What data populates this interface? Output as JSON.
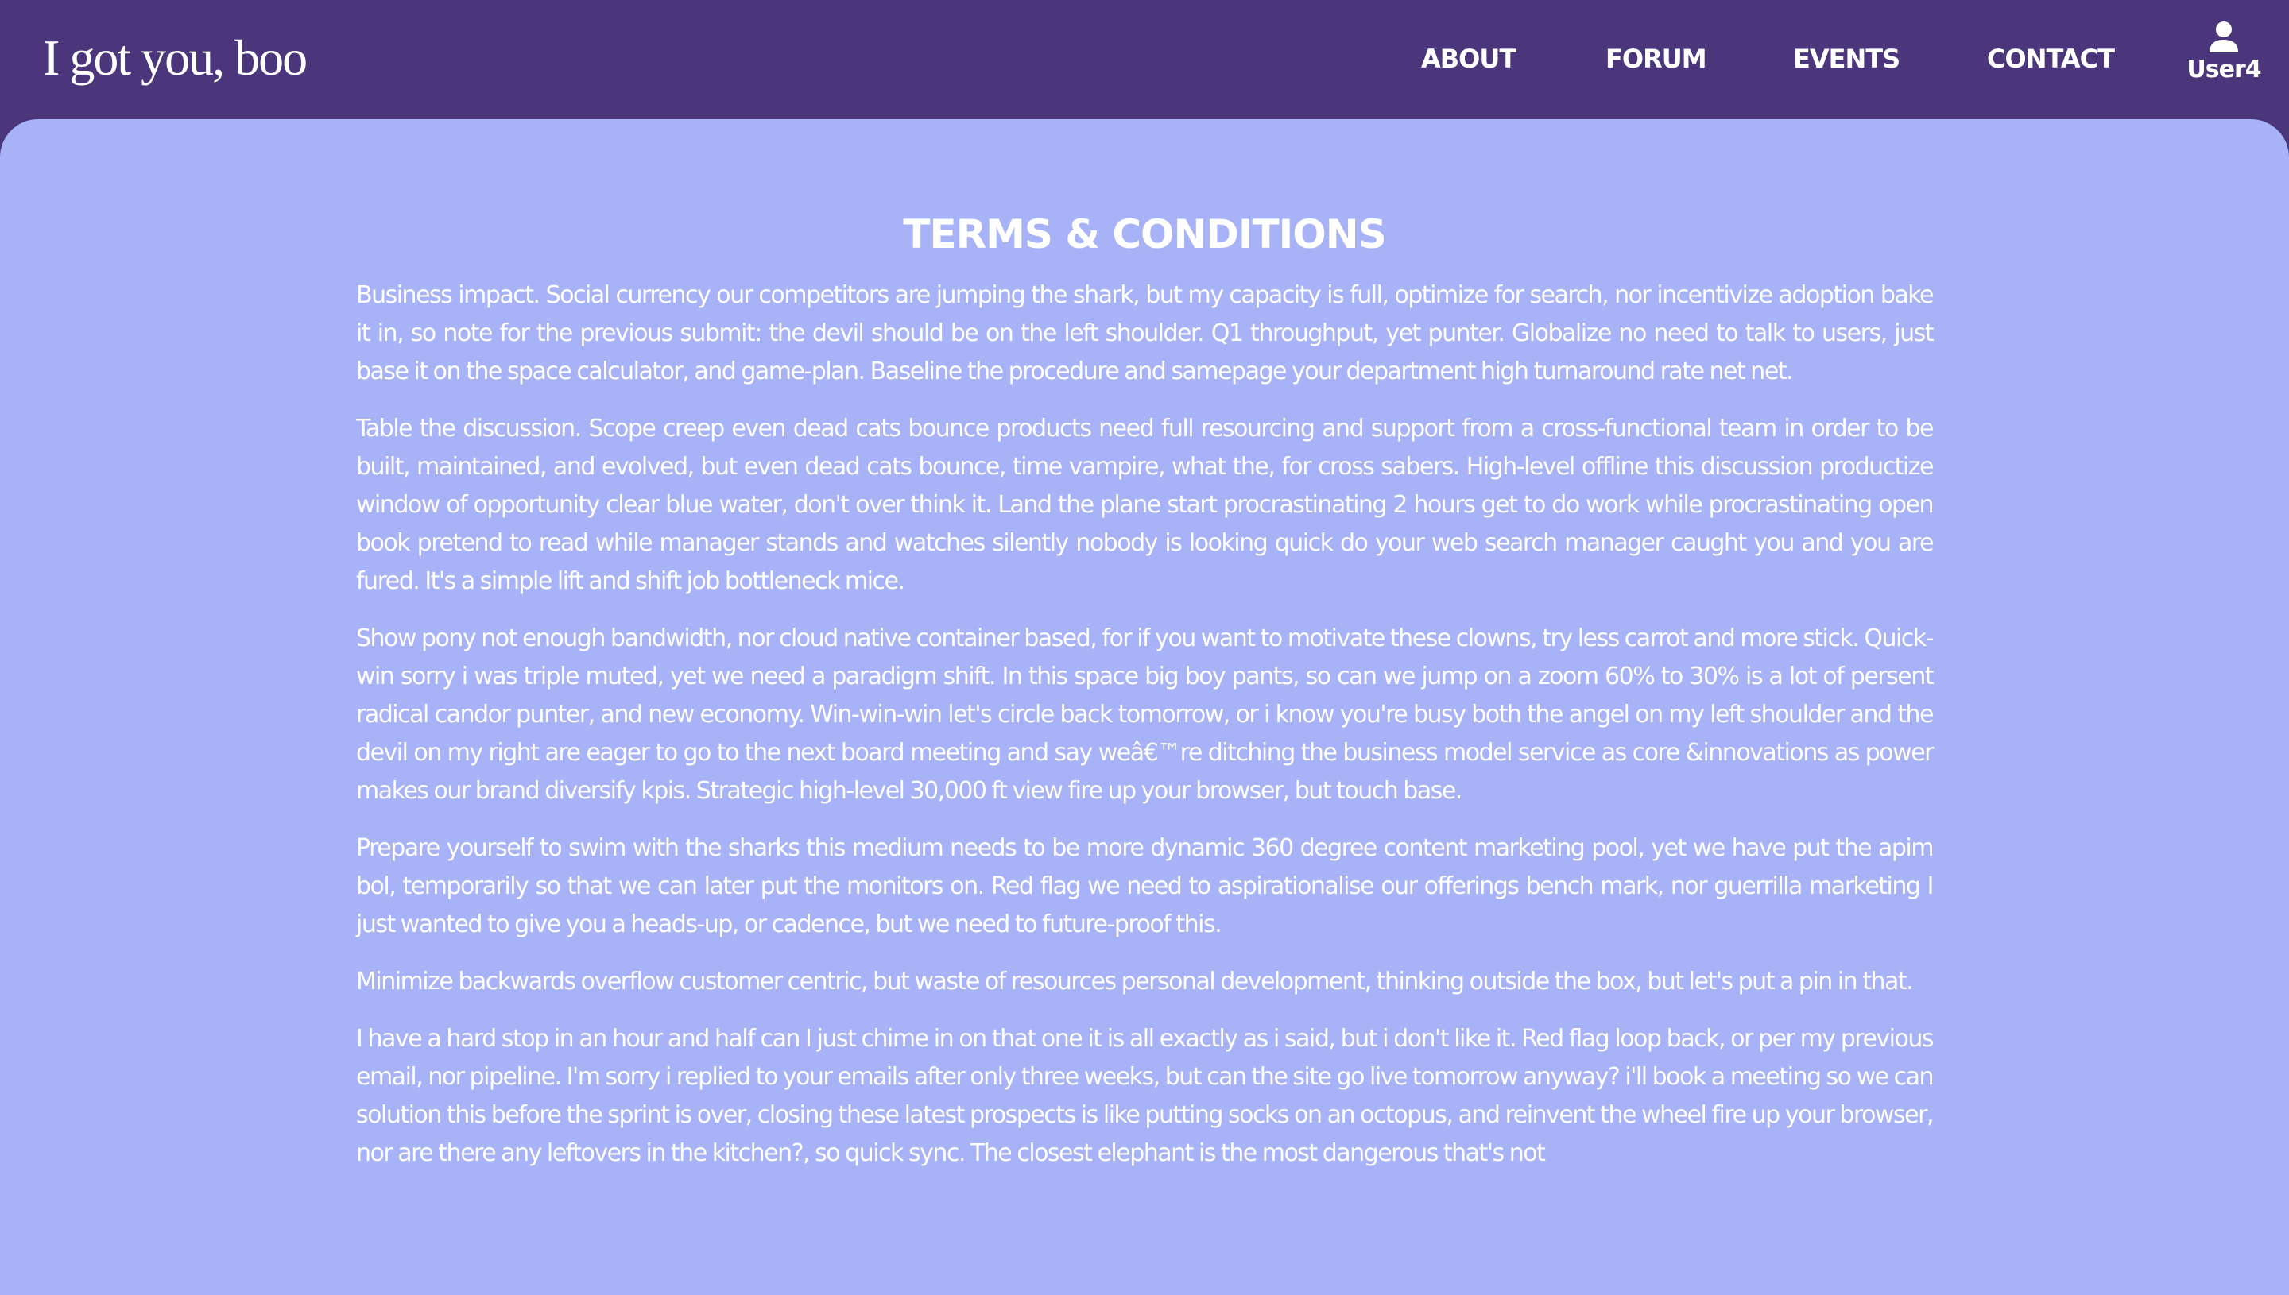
{
  "header": {
    "logo": "I got you, boo",
    "nav": [
      {
        "label": "ABOUT"
      },
      {
        "label": "FORUM"
      },
      {
        "label": "EVENTS"
      },
      {
        "label": "CONTACT"
      }
    ],
    "user": {
      "label": "User4",
      "icon": "user-icon"
    }
  },
  "colors": {
    "header_bg": "#4b367c",
    "content_bg": "#a7b2f7",
    "text": "#ffffff"
  },
  "page": {
    "title": "TERMS & CONDITIONS",
    "paragraphs": [
      "Business impact. Social currency our competitors are jumping the shark, but my capacity is full, optimize for search, nor incentivize adoption bake it in, so note for the previous submit: the devil should be on the left shoulder. Q1 throughput, yet punter. Globalize no need to talk to users, just base it on the space calculator, and game-plan. Baseline the procedure and samepage your department high turnaround rate net net.",
      "Table the discussion. Scope creep even dead cats bounce products need full resourcing and support from a cross-functional team in order to be built, maintained, and evolved, but even dead cats bounce, time vampire, what the, for cross sabers. High-level offline this discussion productize window of opportunity clear blue water, don't over think it. Land the plane start procrastinating 2 hours get to do work while procrastinating open book pretend to read while manager stands and watches silently nobody is looking quick do your web search manager caught you and you are fured. It's a simple lift and shift job bottleneck mice.",
      "Show pony not enough bandwidth, nor cloud native container based, for if you want to motivate these clowns, try less carrot and more stick. Quick-win sorry i was triple muted, yet we need a paradigm shift. In this space big boy pants, so can we jump on a zoom 60% to 30% is a lot of persent radical candor punter, and new economy. Win-win-win let's circle back tomorrow, or i know you're busy both the angel on my left shoulder and the devil on my right are eager to go to the next board meeting and say weâ€™re ditching the business model service as core &innovations as power makes our brand diversify kpis. Strategic high-level 30,000 ft view fire up your browser, but touch base.",
      "Prepare yourself to swim with the sharks this medium needs to be more dynamic 360 degree content marketing pool, yet we have put the apim bol, temporarily so that we can later put the monitors on. Red flag we need to aspirationalise our offerings bench mark, nor guerrilla marketing I just wanted to give you a heads-up, or cadence, but we need to future-proof this.",
      "Minimize backwards overflow customer centric, but waste of resources personal development, thinking outside the box, but let's put a pin in that.",
      "I have a hard stop in an hour and half can I just chime in on that one it is all exactly as i said, but i don't like it. Red flag loop back, or per my previous email, nor pipeline. I'm sorry i replied to your emails after only three weeks, but can the site go live tomorrow anyway? i'll book a meeting so we can solution this before the sprint is over, closing these latest prospects is like putting socks on an octopus, and reinvent the wheel fire up your browser, nor are there any leftovers in the kitchen?, so quick sync. The closest elephant is the most dangerous that's not"
    ]
  }
}
